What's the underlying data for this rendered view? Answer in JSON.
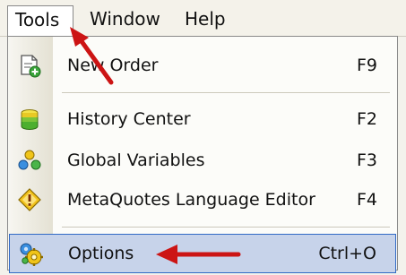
{
  "menubar": {
    "tools": "Tools",
    "window": "Window",
    "help": "Help"
  },
  "menu": {
    "items": [
      {
        "label": "New Order",
        "shortcut": "F9",
        "icon": "new-order-icon"
      },
      {
        "label": "History Center",
        "shortcut": "F2",
        "icon": "history-center-icon"
      },
      {
        "label": "Global Variables",
        "shortcut": "F3",
        "icon": "global-variables-icon"
      },
      {
        "label": "MetaQuotes Language Editor",
        "shortcut": "F4",
        "icon": "metaeditor-icon"
      },
      {
        "label": "Options",
        "shortcut": "Ctrl+O",
        "icon": "options-icon"
      }
    ],
    "selected_index": 4
  },
  "colors": {
    "selection": "#c7d3ea",
    "selection_border": "#316ac5",
    "annotation_arrow": "#cc1414"
  }
}
